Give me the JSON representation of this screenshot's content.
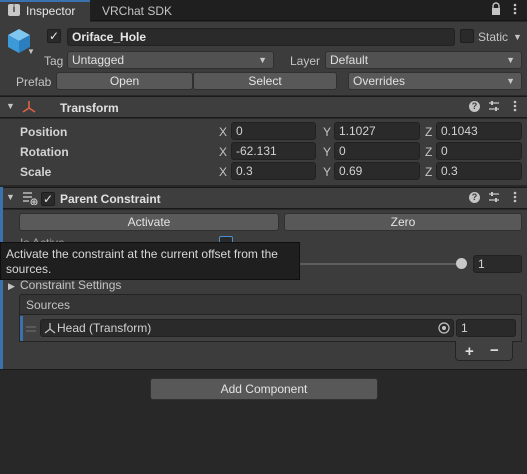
{
  "tabs": [
    {
      "label": "Inspector",
      "icon": "info-icon",
      "active": true
    },
    {
      "label": "VRChat SDK",
      "active": false
    }
  ],
  "tab_actions": {
    "lock_icon": "lock-icon",
    "menu_icon": "kebab-menu-icon"
  },
  "object": {
    "name": "Oriface_Hole",
    "active_checked": true,
    "static_label": "Static",
    "static_checked": false,
    "tag_label": "Tag",
    "tag_value": "Untagged",
    "layer_label": "Layer",
    "layer_value": "Default",
    "prefab_label": "Prefab",
    "open_label": "Open",
    "select_label": "Select",
    "overrides_label": "Overrides"
  },
  "transform": {
    "title": "Transform",
    "rows": [
      {
        "label": "Position",
        "x": "0",
        "y": "1.1027",
        "z": "0.1043"
      },
      {
        "label": "Rotation",
        "x": "-62.131",
        "y": "0",
        "z": "0"
      },
      {
        "label": "Scale",
        "x": "0.3",
        "y": "0.69",
        "z": "0.3"
      }
    ],
    "axis_x": "X",
    "axis_y": "Y",
    "axis_z": "Z"
  },
  "parent_constraint": {
    "title": "Parent Constraint",
    "enabled": true,
    "activate_label": "Activate",
    "zero_label": "Zero",
    "is_active_label": "Is Active",
    "tooltip": "Activate the constraint at the current offset from the sources.",
    "weight_value": "1",
    "weight_slider": 1.0,
    "settings_label": "Constraint Settings",
    "sources_label": "Sources",
    "source_items": [
      {
        "name": "Head (Transform)",
        "weight": "1"
      }
    ]
  },
  "add_component_label": "Add Component",
  "colors": {
    "background": "#282828",
    "header": "#3e3e3e",
    "field": "#2a2a2a",
    "button": "#585858",
    "accent_blue": "#4a8fd0",
    "selection_bar": "#3a72b0"
  }
}
